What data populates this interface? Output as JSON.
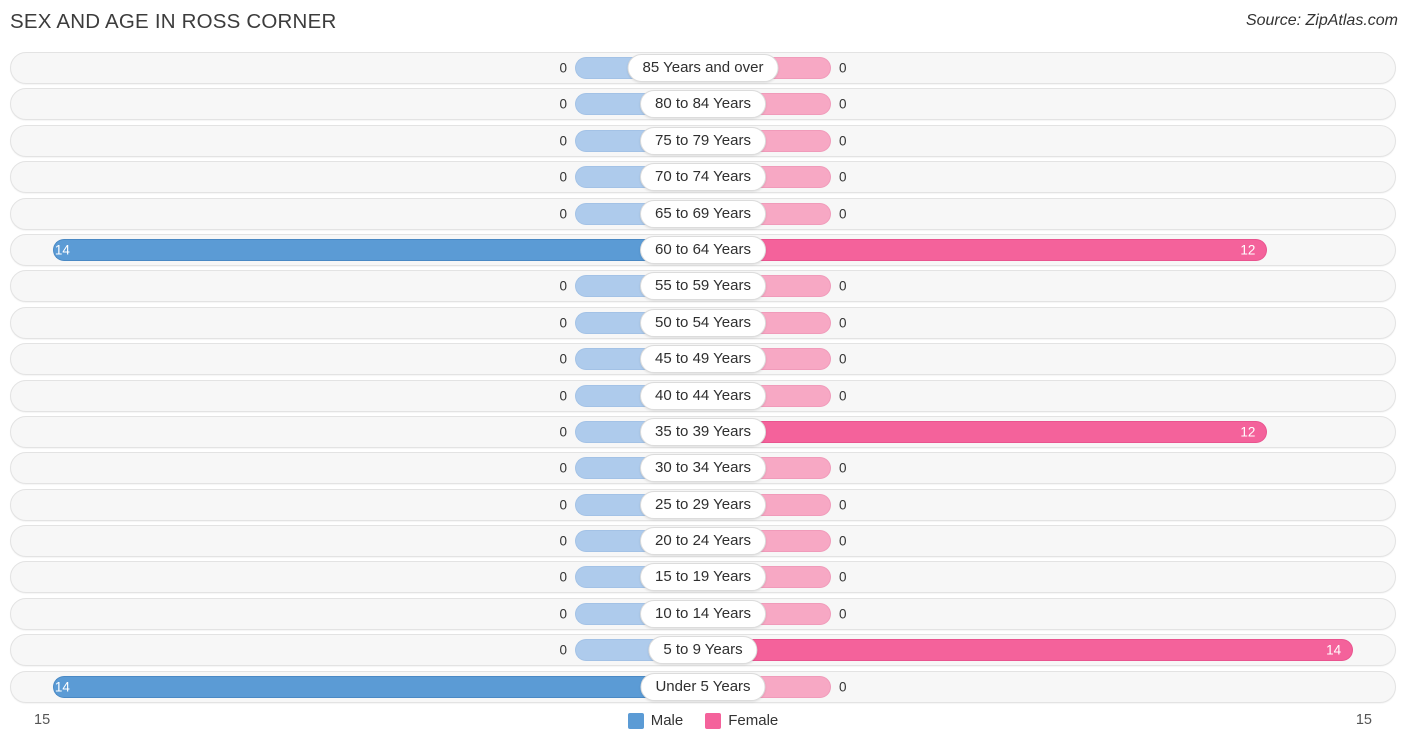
{
  "header": {
    "title": "SEX AND AGE IN ROSS CORNER",
    "source": "Source: ZipAtlas.com"
  },
  "legend": {
    "male_label": "Male",
    "female_label": "Female",
    "male_color": "#5b9bd5",
    "female_color": "#f4629b"
  },
  "axis": {
    "left_max": "15",
    "right_max": "15"
  },
  "chart_data": {
    "type": "bar",
    "title": "SEX AND AGE IN ROSS CORNER",
    "subtype": "population-pyramid",
    "xlabel": "",
    "ylabel": "",
    "xlim": [
      15,
      15
    ],
    "grid": false,
    "legend_position": "bottom-center",
    "categories": [
      "85 Years and over",
      "80 to 84 Years",
      "75 to 79 Years",
      "70 to 74 Years",
      "65 to 69 Years",
      "60 to 64 Years",
      "55 to 59 Years",
      "50 to 54 Years",
      "45 to 49 Years",
      "40 to 44 Years",
      "35 to 39 Years",
      "30 to 34 Years",
      "25 to 29 Years",
      "20 to 24 Years",
      "15 to 19 Years",
      "10 to 14 Years",
      "5 to 9 Years",
      "Under 5 Years"
    ],
    "series": [
      {
        "name": "Male",
        "color": "#5b9bd5",
        "values": [
          0,
          0,
          0,
          0,
          0,
          14,
          0,
          0,
          0,
          0,
          0,
          0,
          0,
          0,
          0,
          0,
          0,
          14
        ]
      },
      {
        "name": "Female",
        "color": "#f4629b",
        "values": [
          0,
          0,
          0,
          0,
          0,
          12,
          0,
          0,
          0,
          0,
          12,
          0,
          0,
          0,
          0,
          0,
          14,
          0
        ]
      }
    ]
  },
  "rows": [
    {
      "label": "85 Years and over",
      "male": "0",
      "female": "0"
    },
    {
      "label": "80 to 84 Years",
      "male": "0",
      "female": "0"
    },
    {
      "label": "75 to 79 Years",
      "male": "0",
      "female": "0"
    },
    {
      "label": "70 to 74 Years",
      "male": "0",
      "female": "0"
    },
    {
      "label": "65 to 69 Years",
      "male": "0",
      "female": "0"
    },
    {
      "label": "60 to 64 Years",
      "male": "14",
      "female": "12"
    },
    {
      "label": "55 to 59 Years",
      "male": "0",
      "female": "0"
    },
    {
      "label": "50 to 54 Years",
      "male": "0",
      "female": "0"
    },
    {
      "label": "45 to 49 Years",
      "male": "0",
      "female": "0"
    },
    {
      "label": "40 to 44 Years",
      "male": "0",
      "female": "0"
    },
    {
      "label": "35 to 39 Years",
      "male": "0",
      "female": "12"
    },
    {
      "label": "30 to 34 Years",
      "male": "0",
      "female": "0"
    },
    {
      "label": "25 to 29 Years",
      "male": "0",
      "female": "0"
    },
    {
      "label": "20 to 24 Years",
      "male": "0",
      "female": "0"
    },
    {
      "label": "15 to 19 Years",
      "male": "0",
      "female": "0"
    },
    {
      "label": "10 to 14 Years",
      "male": "0",
      "female": "0"
    },
    {
      "label": "5 to 9 Years",
      "male": "0",
      "female": "14"
    },
    {
      "label": "Under 5 Years",
      "male": "14",
      "female": "0"
    }
  ]
}
